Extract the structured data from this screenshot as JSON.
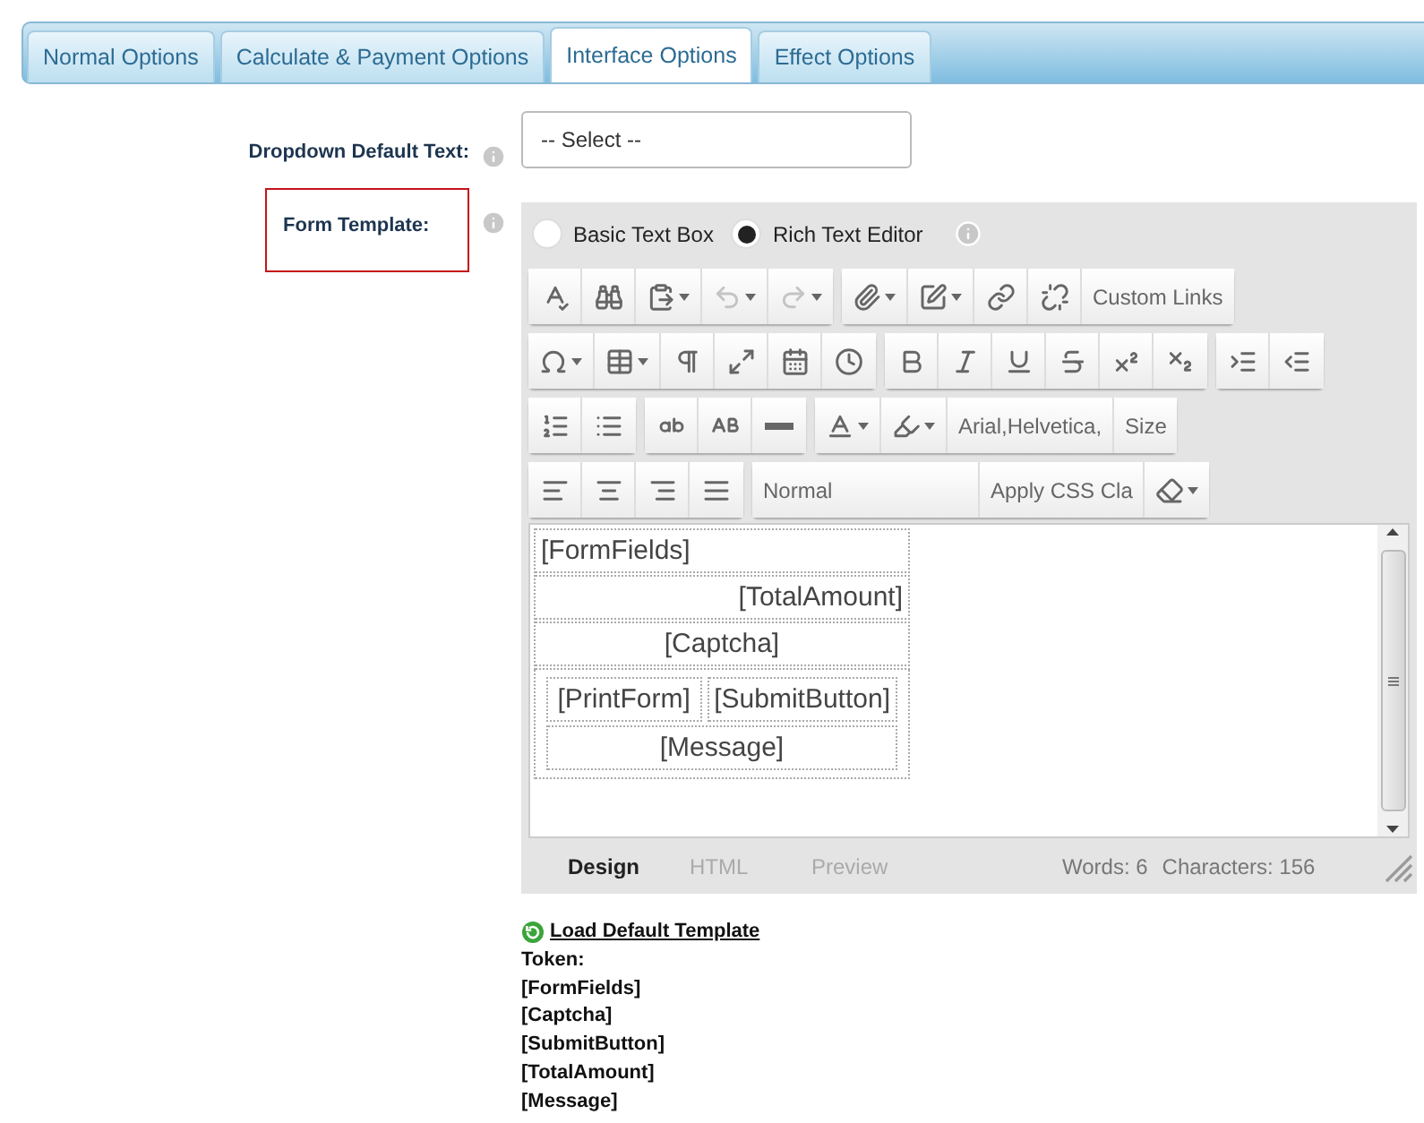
{
  "tabs": [
    {
      "label": "Normal Options",
      "selected": false
    },
    {
      "label": "Calculate & Payment Options",
      "selected": false
    },
    {
      "label": "Interface Options",
      "selected": true
    },
    {
      "label": "Effect Options",
      "selected": false
    }
  ],
  "dropdown_default_text": {
    "label": "Dropdown Default Text:",
    "value": "-- Select --"
  },
  "form_template": {
    "label": "Form Template:",
    "highlighted": true,
    "modes": [
      {
        "label": "Basic Text Box",
        "selected": false
      },
      {
        "label": "Rich Text Editor",
        "selected": true
      }
    ],
    "toolbar_rows": [
      {
        "groups": [
          {
            "buttons": [
              {
                "kind": "icon",
                "dropdown": false,
                "disabled": false
              },
              {
                "kind": "icon",
                "dropdown": false,
                "disabled": false
              },
              {
                "kind": "icon",
                "dropdown": true,
                "disabled": false
              },
              {
                "kind": "icon",
                "dropdown": true,
                "disabled": true
              },
              {
                "kind": "icon",
                "dropdown": true,
                "disabled": true
              }
            ]
          },
          {
            "buttons": [
              {
                "kind": "icon",
                "dropdown": true,
                "disabled": false
              },
              {
                "kind": "icon",
                "dropdown": true,
                "disabled": false
              },
              {
                "kind": "icon",
                "dropdown": false,
                "disabled": false
              },
              {
                "kind": "icon",
                "dropdown": false,
                "disabled": false
              },
              {
                "kind": "text",
                "label": "Custom Links"
              }
            ]
          }
        ]
      },
      {
        "groups": [
          {
            "buttons": [
              {
                "kind": "icon",
                "dropdown": true,
                "disabled": false
              },
              {
                "kind": "icon",
                "dropdown": true,
                "disabled": false
              },
              {
                "kind": "icon",
                "dropdown": false,
                "disabled": false
              },
              {
                "kind": "icon",
                "dropdown": false,
                "disabled": false
              },
              {
                "kind": "icon",
                "dropdown": false,
                "disabled": false
              },
              {
                "kind": "icon",
                "dropdown": false,
                "disabled": false
              }
            ]
          },
          {
            "buttons": [
              {
                "kind": "icon",
                "dropdown": false,
                "disabled": false
              },
              {
                "kind": "icon",
                "dropdown": false,
                "disabled": false
              },
              {
                "kind": "icon",
                "dropdown": false,
                "disabled": false
              },
              {
                "kind": "icon",
                "dropdown": false,
                "disabled": false
              },
              {
                "kind": "icon",
                "dropdown": false,
                "disabled": false
              },
              {
                "kind": "icon",
                "dropdown": false,
                "disabled": false
              }
            ]
          },
          {
            "buttons": [
              {
                "kind": "icon",
                "dropdown": false,
                "disabled": false
              },
              {
                "kind": "icon",
                "dropdown": false,
                "disabled": false
              }
            ]
          }
        ]
      },
      {
        "groups": [
          {
            "buttons": [
              {
                "kind": "icon",
                "dropdown": false,
                "disabled": false
              },
              {
                "kind": "icon",
                "dropdown": false,
                "disabled": false
              }
            ]
          },
          {
            "buttons": [
              {
                "kind": "icon",
                "dropdown": false,
                "disabled": false
              },
              {
                "kind": "icon",
                "dropdown": false,
                "disabled": false
              },
              {
                "kind": "icon",
                "dropdown": false,
                "disabled": false
              }
            ]
          },
          {
            "buttons": [
              {
                "kind": "icon",
                "dropdown": true,
                "disabled": false
              },
              {
                "kind": "icon",
                "dropdown": true,
                "disabled": false
              },
              {
                "kind": "combo",
                "label": "Arial,Helvetica,"
              },
              {
                "kind": "combo",
                "label": "Size"
              }
            ]
          }
        ]
      },
      {
        "groups": [
          {
            "buttons": [
              {
                "kind": "icon",
                "dropdown": false,
                "disabled": false
              },
              {
                "kind": "icon",
                "dropdown": false,
                "disabled": false
              },
              {
                "kind": "icon",
                "dropdown": false,
                "disabled": false
              },
              {
                "kind": "icon",
                "dropdown": false,
                "disabled": false
              }
            ]
          },
          {
            "buttons": [
              {
                "kind": "combo",
                "label": "Normal"
              },
              {
                "kind": "combo",
                "label": "Apply CSS Cla"
              },
              {
                "kind": "icon",
                "dropdown": true,
                "disabled": false
              }
            ]
          }
        ]
      }
    ],
    "content": [
      {
        "kind": "left",
        "text": "[FormFields]"
      },
      {
        "kind": "right",
        "text": "[TotalAmount]"
      },
      {
        "kind": "center",
        "text": "[Captcha]"
      },
      {
        "kind": "nested",
        "rows": [
          {
            "cells": [
              {
                "kind": "center",
                "text": "[PrintForm]"
              },
              {
                "kind": "center",
                "text": "[SubmitButton]"
              }
            ]
          },
          {
            "cells": [
              {
                "kind": "center",
                "text": "[Message]"
              }
            ]
          }
        ]
      }
    ],
    "view_tabs": [
      {
        "label": "Design",
        "selected": true
      },
      {
        "label": "HTML",
        "selected": false
      },
      {
        "label": "Preview",
        "selected": false
      }
    ],
    "words": "Words: 6",
    "characters": "Characters: 156",
    "load_default_link": "Load Default Template",
    "token_heading": "Token:",
    "tokens": [
      "[FormFields]",
      "[Captcha]",
      "[SubmitButton]",
      "[TotalAmount]",
      "[Message]"
    ]
  }
}
